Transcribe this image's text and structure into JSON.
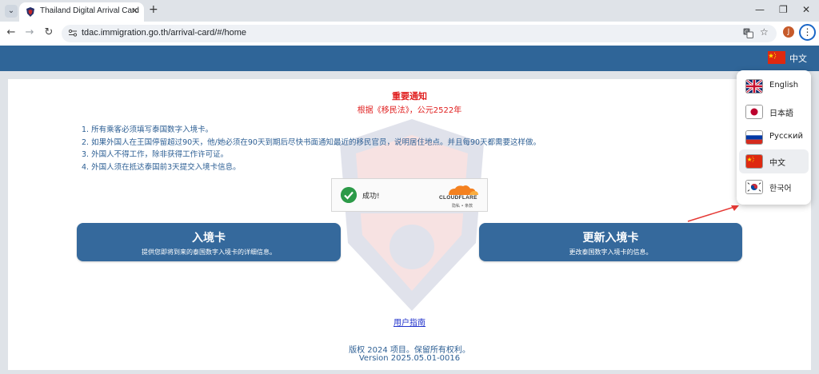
{
  "browser": {
    "tab_title": "Thailand Digital Arrival Card",
    "url": "tdac.immigration.go.th/arrival-card/#/home",
    "profile_initial": "J"
  },
  "header": {
    "current_language": "中文"
  },
  "notice": {
    "title": "重要通知",
    "subtitle": "根据《移民法》，公元2522年",
    "rules": [
      "1. 所有乘客必须填写泰国数字入境卡。",
      "2. 如果外国人在王国停留超过90天，他/她必须在90天到期后尽快书面通知最近的移民官员，说明居住地点。并且每90天都需要这样做。",
      "3. 外国人不得工作，除非获得工作许可证。",
      "4. 外国人须在抵达泰国前3天提交入境卡信息。"
    ]
  },
  "captcha": {
    "status": "成功!",
    "brand": "CLOUDFLARE",
    "links": "隐私 • 条款"
  },
  "actions": {
    "arrival_title": "入境卡",
    "arrival_sub": "提供您即将到来的泰国数字入境卡的详细信息。",
    "update_title": "更新入境卡",
    "update_sub": "更改泰国数字入境卡的信息。"
  },
  "footer": {
    "guide_link": "用户指南",
    "copyright": "版权 2024 项目。保留所有权利。",
    "version": "Version 2025.05.01-0016"
  },
  "language_menu": [
    {
      "label": "English",
      "flag": "gb-flag-icon",
      "active": false
    },
    {
      "label": "日本語",
      "flag": "jp-flag-icon",
      "active": false
    },
    {
      "label": "Русский",
      "flag": "ru-flag-icon",
      "active": false
    },
    {
      "label": "中文",
      "flag": "cn-flag-icon",
      "active": true
    },
    {
      "label": "한국어",
      "flag": "kr-flag-icon",
      "active": false
    }
  ],
  "colors": {
    "header_blue": "#2f6598",
    "button_blue": "#35699c",
    "notice_red": "#e02020",
    "text_blue": "#2d5f94"
  }
}
